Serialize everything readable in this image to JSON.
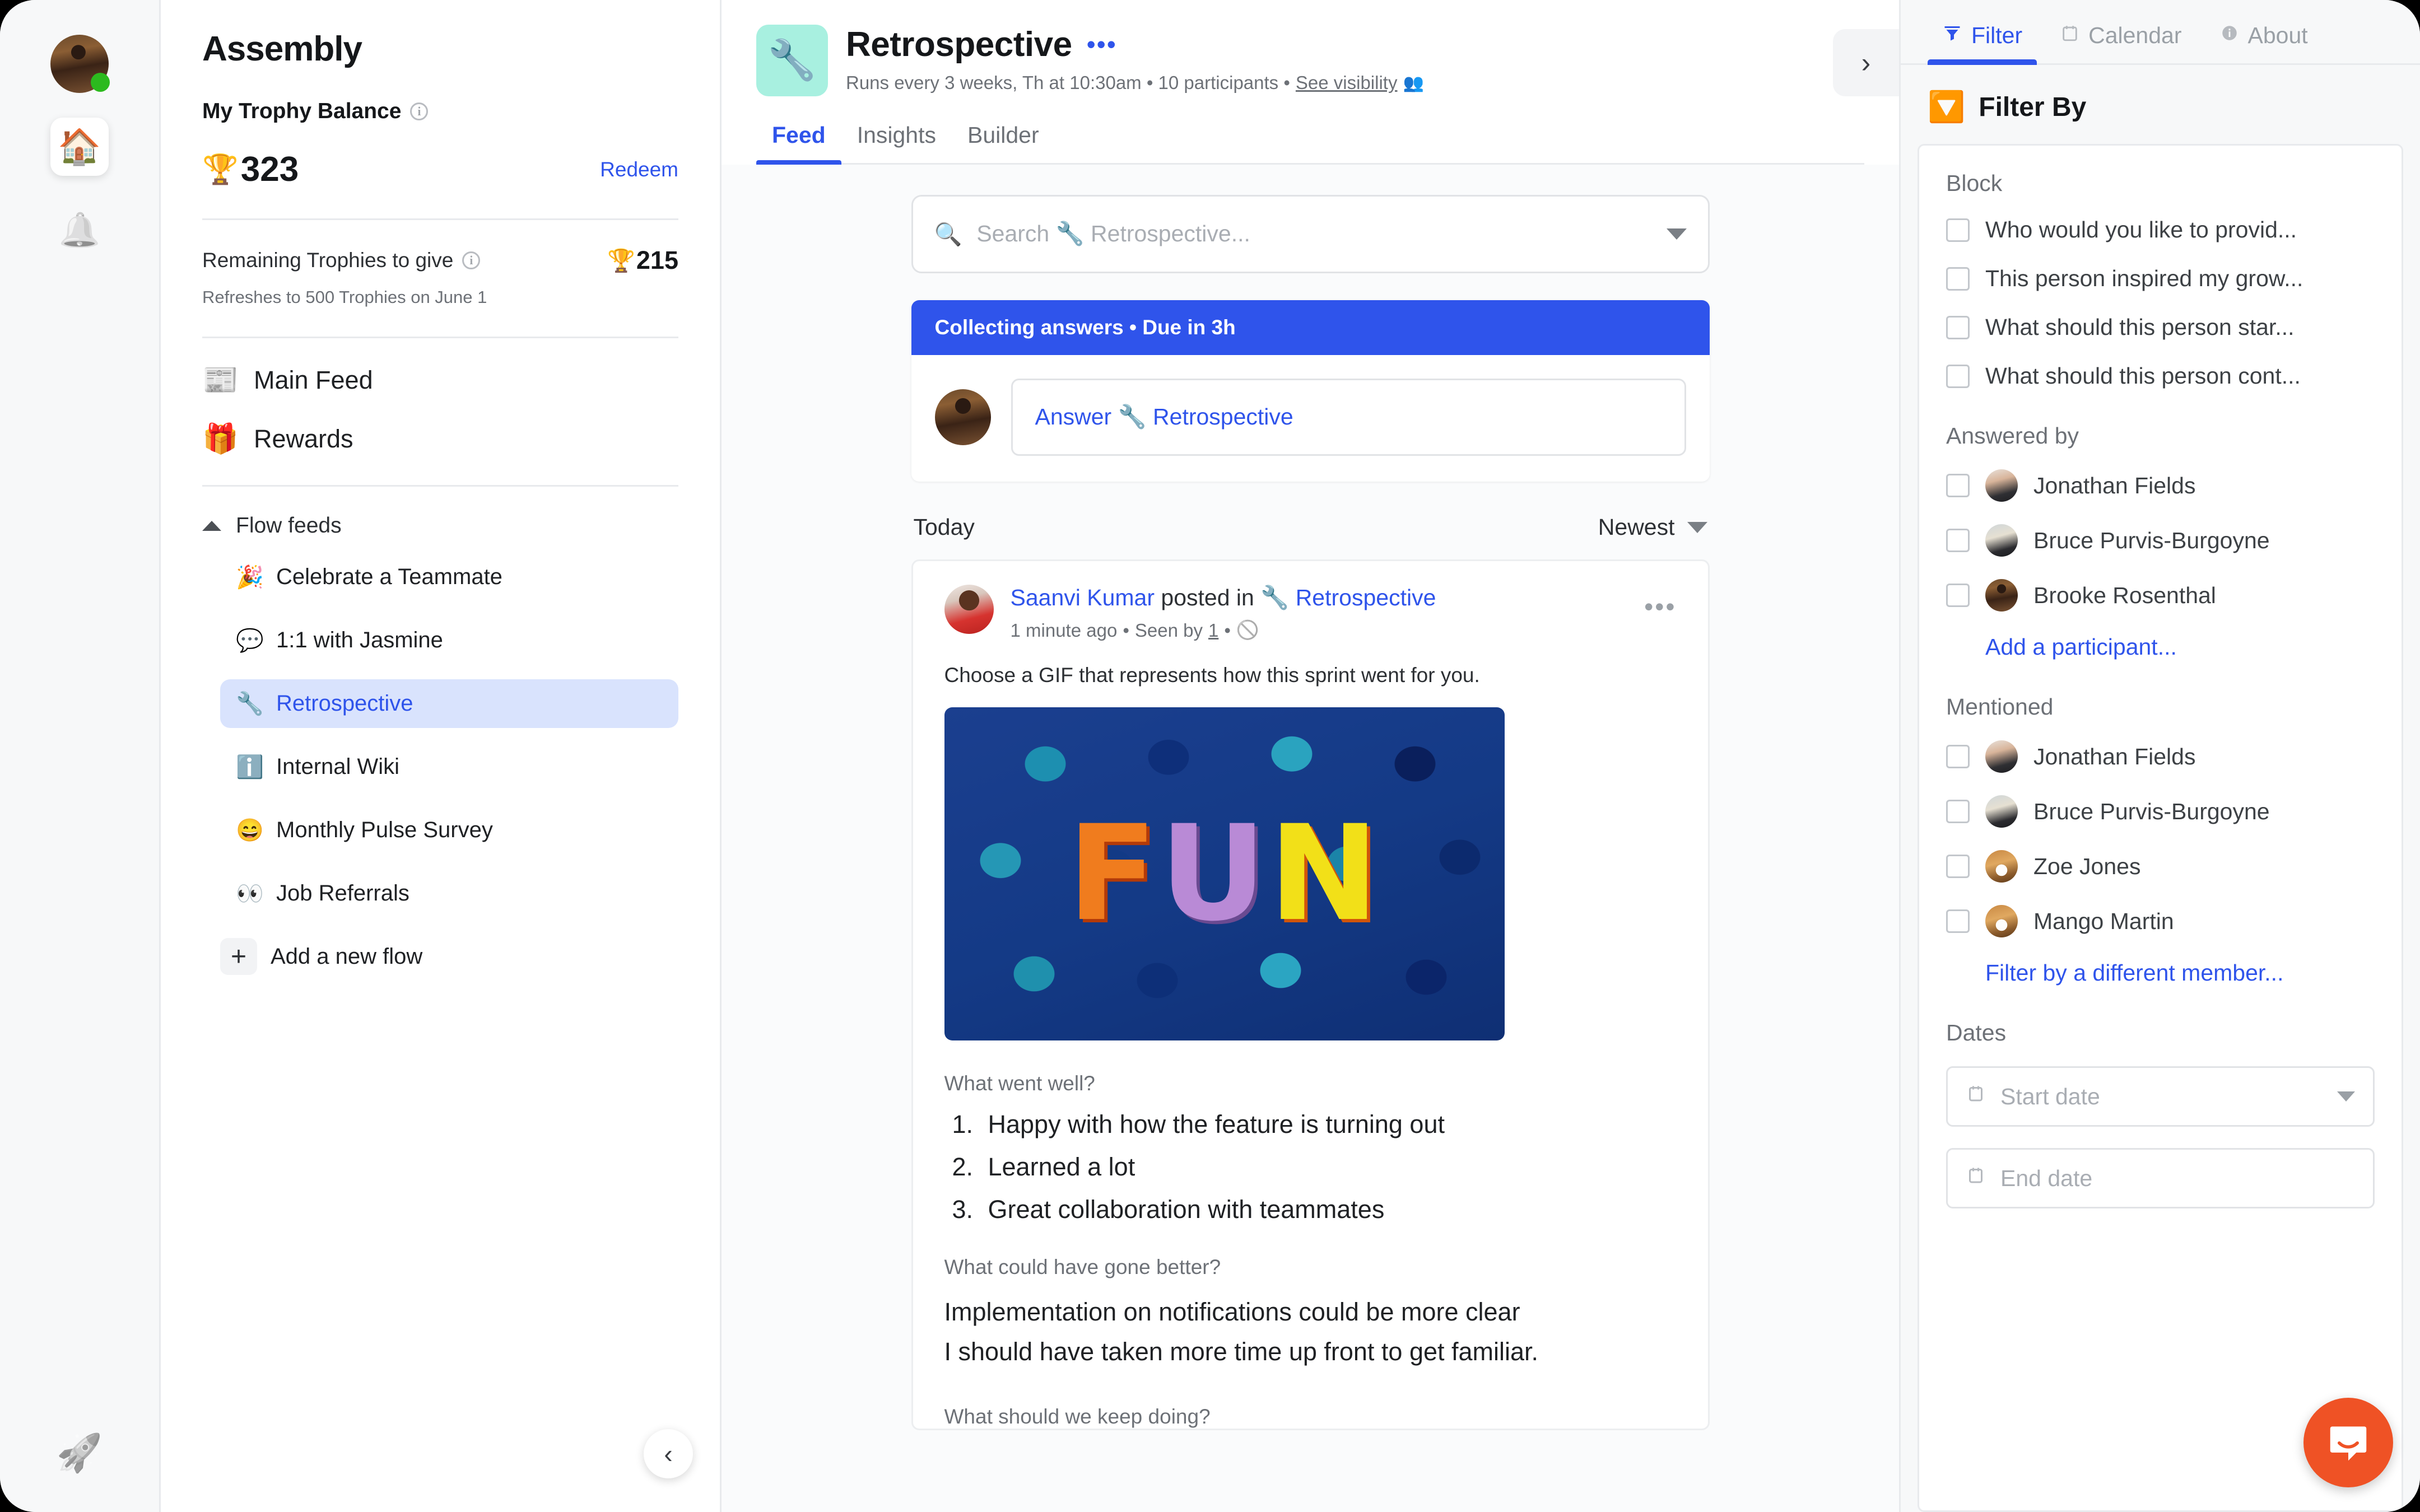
{
  "colors": {
    "accent": "#2f54eb",
    "accent_soft": "#d9e3fd",
    "flow_icon_bg": "#a8f0e0",
    "intercom": "#ef5225",
    "online": "#2cba1e"
  },
  "rail": {
    "avatar_name": "user-avatar",
    "items": [
      {
        "name": "home-icon",
        "glyph": "🏠",
        "active": true
      },
      {
        "name": "notifications-bell-icon",
        "glyph": "🔔",
        "active": false
      }
    ],
    "bottom_icon": "admin-settings-icon"
  },
  "sidebar": {
    "brand": "Assembly",
    "trophy_balance_label": "My Trophy Balance",
    "trophy_balance_value": "323",
    "trophy_emoji": "🏆",
    "redeem_label": "Redeem",
    "remaining_label": "Remaining Trophies to give",
    "remaining_value": "215",
    "refresh_note": "Refreshes to 500 Trophies on June 1",
    "nav": [
      {
        "emoji": "📰",
        "label": "Main Feed"
      },
      {
        "emoji": "🎁",
        "label": "Rewards"
      }
    ],
    "flow_feeds_label": "Flow feeds",
    "flows": [
      {
        "emoji": "🎉",
        "label": "Celebrate a Teammate",
        "selected": false
      },
      {
        "emoji": "💬",
        "label": "1:1 with Jasmine",
        "selected": false
      },
      {
        "emoji": "🔧",
        "label": "Retrospective",
        "selected": true
      },
      {
        "emoji": "ℹ️",
        "label": "Internal Wiki",
        "selected": false
      },
      {
        "emoji": "😄",
        "label": "Monthly Pulse Survey",
        "selected": false
      },
      {
        "emoji": "👀",
        "label": "Job Referrals",
        "selected": false
      }
    ],
    "add_flow_label": "Add a new flow",
    "add_flow_plus": "+",
    "collapse_glyph": "‹"
  },
  "main": {
    "flow_emoji": "🔧",
    "title": "Retrospective",
    "more_dots": "•••",
    "subtitle": "Runs every 3 weeks, Th at 10:30am • 10 participants •",
    "see_visibility": "See visibility",
    "visibility_icon_glyph": "👥",
    "panel_toggle_glyph": "›",
    "tabs": [
      {
        "label": "Feed",
        "active": true
      },
      {
        "label": "Insights",
        "active": false
      },
      {
        "label": "Builder",
        "active": false
      }
    ],
    "search": {
      "placeholder": "Search 🔧 Retrospective...",
      "icon": "search-icon"
    },
    "collecting": {
      "status": "Collecting answers • Due in 3h",
      "answer_label": "Answer 🔧 Retrospective"
    },
    "feed_group_label": "Today",
    "sort_label": "Newest",
    "post": {
      "author": "Saanvi Kumar",
      "posted_in_text": "posted in",
      "flow_emoji": "🔧",
      "flow_name": "Retrospective",
      "time_ago": "1 minute ago",
      "seen_by_text": "Seen by",
      "seen_by_count": "1",
      "hidden_icon_glyph": "🚫",
      "more_dots": "•••",
      "gif_prompt": "Choose a GIF that represents how this sprint went for you.",
      "gif_letters": [
        "F",
        "U",
        "N"
      ],
      "blocks": [
        {
          "question": "What went well?",
          "type": "ordered-list",
          "items": [
            "Happy with how the feature is turning out",
            "Learned a lot",
            "Great collaboration with teammates"
          ]
        },
        {
          "question": "What could have gone better?",
          "type": "paragraph",
          "lines": [
            "Implementation on notifications could be more clear",
            "I should have taken more time up front to get familiar."
          ]
        },
        {
          "question": "What should we keep doing?",
          "type": "cutoff",
          "items": []
        }
      ]
    }
  },
  "right_panel": {
    "tabs": [
      {
        "label": "Filter",
        "icon": "funnel-icon",
        "glyph": "∇",
        "active": true
      },
      {
        "label": "Calendar",
        "icon": "calendar-icon",
        "glyph": "🗓",
        "active": false
      },
      {
        "label": "About",
        "icon": "info-circle-icon",
        "glyph": "ⓘ",
        "active": false
      }
    ],
    "header_emoji": "🔽",
    "header_label": "Filter By",
    "groups": {
      "block": {
        "title": "Block",
        "options": [
          "Who would you like to provid...",
          "This person inspired my grow...",
          "What should this person star...",
          "What should this person cont..."
        ]
      },
      "answered_by": {
        "title": "Answered by",
        "people": [
          {
            "name": "Jonathan Fields",
            "avatar": "ava-jon"
          },
          {
            "name": "Bruce Purvis-Burgoyne",
            "avatar": "ava-bruce"
          },
          {
            "name": "Brooke Rosenthal",
            "avatar": "ava-brooke"
          }
        ],
        "add_link": "Add a participant..."
      },
      "mentioned": {
        "title": "Mentioned",
        "people": [
          {
            "name": "Jonathan Fields",
            "avatar": "ava-jon"
          },
          {
            "name": "Bruce Purvis-Burgoyne",
            "avatar": "ava-bruce"
          },
          {
            "name": "Zoe Jones",
            "avatar": "ava-dog"
          },
          {
            "name": "Mango Martin",
            "avatar": "ava-dog"
          }
        ],
        "filter_link": "Filter by a different member..."
      },
      "dates": {
        "title": "Dates",
        "start_placeholder": "Start date",
        "end_placeholder": "End date"
      }
    }
  },
  "intercom": {
    "name": "intercom-chat-launcher"
  }
}
